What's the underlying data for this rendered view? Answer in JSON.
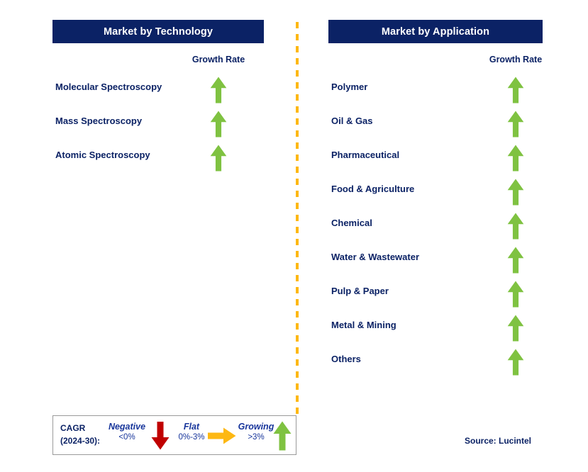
{
  "colors": {
    "navy": "#0B2265",
    "green": "#7FC241",
    "red": "#C00000",
    "amber": "#FDB813",
    "legend_text": "#17359B",
    "divider": "#FDB813"
  },
  "panels": [
    {
      "id": "technology",
      "title": "Market by Technology",
      "growth_rate_label": "Growth Rate",
      "items": [
        {
          "label": "Molecular Spectroscopy",
          "trend": "growing",
          "arrow_icon": "arrow-up-icon"
        },
        {
          "label": "Mass Spectroscopy",
          "trend": "growing",
          "arrow_icon": "arrow-up-icon"
        },
        {
          "label": "Atomic Spectroscopy",
          "trend": "growing",
          "arrow_icon": "arrow-up-icon"
        }
      ]
    },
    {
      "id": "application",
      "title": "Market by Application",
      "growth_rate_label": "Growth Rate",
      "items": [
        {
          "label": "Polymer",
          "trend": "growing",
          "arrow_icon": "arrow-up-icon"
        },
        {
          "label": "Oil & Gas",
          "trend": "growing",
          "arrow_icon": "arrow-up-icon"
        },
        {
          "label": "Pharmaceutical",
          "trend": "growing",
          "arrow_icon": "arrow-up-icon"
        },
        {
          "label": "Food & Agriculture",
          "trend": "growing",
          "arrow_icon": "arrow-up-icon"
        },
        {
          "label": "Chemical",
          "trend": "growing",
          "arrow_icon": "arrow-up-icon"
        },
        {
          "label": "Water & Wastewater",
          "trend": "growing",
          "arrow_icon": "arrow-up-icon"
        },
        {
          "label": "Pulp & Paper",
          "trend": "growing",
          "arrow_icon": "arrow-up-icon"
        },
        {
          "label": "Metal & Mining",
          "trend": "growing",
          "arrow_icon": "arrow-up-icon"
        },
        {
          "label": "Others",
          "trend": "growing",
          "arrow_icon": "arrow-up-icon"
        }
      ]
    }
  ],
  "legend": {
    "cagr_line1": "CAGR",
    "cagr_line2": "(2024-30):",
    "entries": [
      {
        "title": "Negative",
        "range": "<0%",
        "arrow_icon": "arrow-down-icon",
        "color": "#C00000"
      },
      {
        "title": "Flat",
        "range": "0%-3%",
        "arrow_icon": "arrow-right-icon",
        "color": "#FDB813"
      },
      {
        "title": "Growing",
        "range": ">3%",
        "arrow_icon": "arrow-up-icon",
        "color": "#7FC241"
      }
    ]
  },
  "source": "Source: Lucintel"
}
